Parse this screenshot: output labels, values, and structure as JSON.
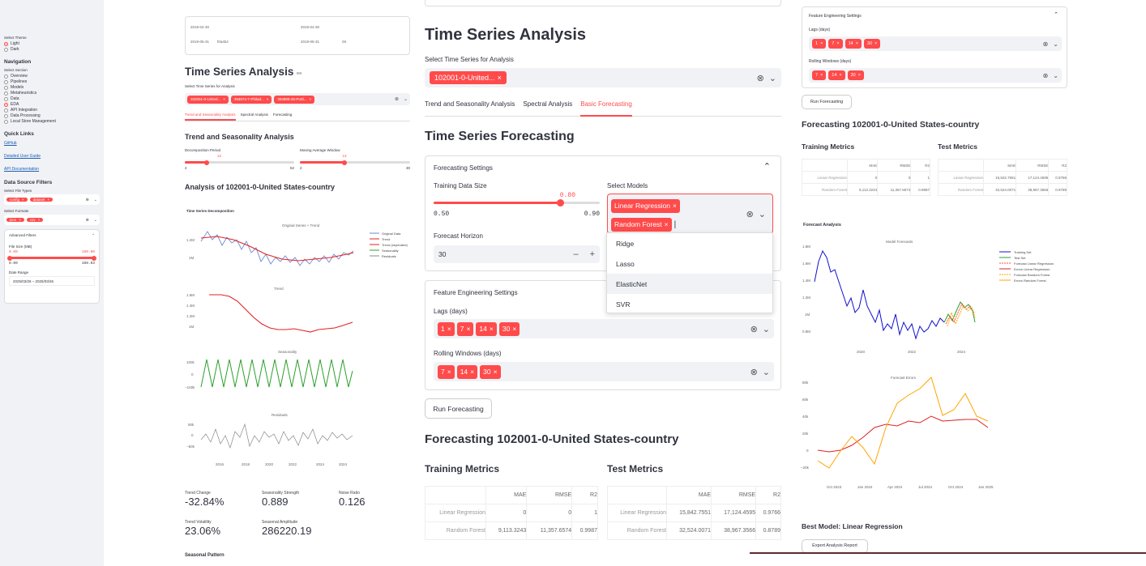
{
  "sidebar": {
    "theme_label": "Select Theme",
    "themes": [
      "Light",
      "Dark"
    ],
    "nav_title": "Navigation",
    "section_label": "Select Section",
    "sections": [
      "Overview",
      "Pipelines",
      "Models",
      "Metaheuristics",
      "Data",
      "EDA",
      "API Integration",
      "Data Processing",
      "Local Store Management"
    ],
    "quick_links_title": "Quick Links",
    "links": [
      "GitHub",
      "Detailed User Guide",
      "API Documentation"
    ],
    "filters_title": "Data Source Filters",
    "file_types_label": "Select File Types",
    "file_types": [
      "config",
      "dataset"
    ],
    "formats_label": "Select Formats",
    "formats": [
      "json",
      "csv"
    ],
    "adv_title": "Advanced Filters",
    "file_size_label": "File Size (MB)",
    "size_min": "0.00",
    "size_max": "100.00",
    "size_low": "0.00",
    "size_high": "108.63",
    "date_label": "Date Range",
    "date_value": "2025/03/26 – 2025/03/26"
  },
  "p1": {
    "table_rows": [
      [
        "2019-04-30",
        "",
        "2019-04-30",
        ""
      ],
      [
        "2019-05-31",
        "f0a4b4",
        "2019-05-31",
        "29"
      ]
    ],
    "title": "Time Series Analysis",
    "select_label": "Select Time Series for Analysis",
    "tags": [
      "102001-0-United...",
      "394974-7-Philad...",
      "394998-25-Portl..."
    ],
    "tabs": [
      "Trend and Seasonality Analysis",
      "Spectral Analysis",
      "Forecasting"
    ],
    "trend_title": "Trend and Seasonality Analysis",
    "decomp_label": "Decomposition Period",
    "decomp_val": "12",
    "decomp_min": "2",
    "decomp_max": "52",
    "ma_label": "Moving Average Window",
    "ma_val": "13",
    "ma_min": "2",
    "ma_max": "30",
    "analysis_title": "Analysis of 102001-0-United States-country",
    "decomp_chart_title": "Time Series Decomposition",
    "sub_titles": [
      "Original Series + Trend",
      "Trend",
      "Seasonality",
      "Residuals"
    ],
    "legend": [
      "Original Data",
      "Trend",
      "Trend (seperated)",
      "Seasonality",
      "Residuals"
    ],
    "metrics": [
      {
        "label": "Trend Change",
        "value": "-32.84%"
      },
      {
        "label": "Seasonality Strength",
        "value": "0.889"
      },
      {
        "label": "Noise Ratio",
        "value": "0.126"
      },
      {
        "label": "Trend Volatility",
        "value": "23.06%"
      },
      {
        "label": "Seasonal Amplitude",
        "value": "286220.19"
      }
    ],
    "seasonal_pattern": "Seasonal Pattern",
    "y_top": [
      "1.2M",
      "1M"
    ],
    "y_trend": [
      "1.6M",
      "1.4M",
      "1.2M",
      "1M"
    ],
    "y_seas": [
      "100k",
      "0",
      "−100k"
    ],
    "y_res": [
      "50k",
      "0",
      "−50k"
    ],
    "x_years": [
      "2016",
      "2018",
      "2020",
      "2022",
      "2024"
    ]
  },
  "p2": {
    "title": "Time Series Analysis",
    "select_label": "Select Time Series for Analysis",
    "tag": "102001-0-United...",
    "tabs": [
      "Trend and Seasonality Analysis",
      "Spectral Analysis",
      "Basic Forecasting"
    ],
    "forecast_title": "Time Series Forecasting",
    "settings_title": "Forecasting Settings",
    "train_label": "Training Data Size",
    "train_val": "0.80",
    "train_min": "0.50",
    "train_max": "0.90",
    "models_label": "Select Models",
    "models": [
      "Linear Regression",
      "Random Forest"
    ],
    "horizon_label": "Forecast Horizon",
    "horizon_val": "30",
    "menu": [
      "Ridge",
      "Lasso",
      "ElasticNet",
      "SVR"
    ],
    "fe_title": "Feature Engineering Settings",
    "lags_label": "Lags (days)",
    "lags": [
      "1",
      "7",
      "14",
      "30"
    ],
    "roll_label": "Rolling Windows (days)",
    "rolls": [
      "7",
      "14",
      "30"
    ],
    "run_btn": "Run Forecasting",
    "result_title": "Forecasting 102001-0-United States-country",
    "train_metrics": "Training Metrics",
    "test_metrics": "Test Metrics",
    "cols": [
      "MAE",
      "RMSE",
      "R2"
    ],
    "train_rows": [
      [
        "Linear Regression",
        "0",
        "0",
        "1"
      ],
      [
        "Random Forest",
        "9,113.3243",
        "11,357.6574",
        "0.9987"
      ]
    ],
    "test_rows": [
      [
        "Linear Regression",
        "15,842.7551",
        "17,124.4595",
        "0.9766"
      ],
      [
        "Random Forest",
        "32,524.0071",
        "38,967.3566",
        "0.8789"
      ]
    ]
  },
  "p3": {
    "fe_title": "Feature Engineering Settings",
    "lags_label": "Lags (days)",
    "lags": [
      "1",
      "7",
      "14",
      "30"
    ],
    "roll_label": "Rolling Windows (days)",
    "rolls": [
      "7",
      "14",
      "30"
    ],
    "run_btn": "Run Forecasting",
    "result_title": "Forecasting 102001-0-United States-country",
    "train_metrics": "Training Metrics",
    "test_metrics": "Test Metrics",
    "analysis_title": "Forecast Analysis",
    "model_chart_title": "Model Forecasts",
    "err_chart_title": "Forecast Errors",
    "legend": [
      "Training Set",
      "Test Set",
      "Forecast Linear Regression",
      "Errors Linear Regression",
      "Forecast Random Forest",
      "Errors Random Forest"
    ],
    "y_model": [
      "1.8M",
      "1.6M",
      "1.4M",
      "1.2M",
      "1M",
      "0.8M"
    ],
    "x_model": [
      "2020",
      "2022",
      "2024"
    ],
    "y_err": [
      "80k",
      "60k",
      "40k",
      "20k",
      "0",
      "−20k"
    ],
    "x_err": [
      "Oct 2023",
      "Jan 2024",
      "Apr 2024",
      "Jul 2024",
      "Oct 2024",
      "Jan 2025"
    ],
    "best_model": "Best Model: Linear Regression",
    "export_btn": "Export Analysis Report"
  },
  "colors": {
    "accent": "#ff4b4b",
    "sidebar": "#f0f2f6"
  }
}
